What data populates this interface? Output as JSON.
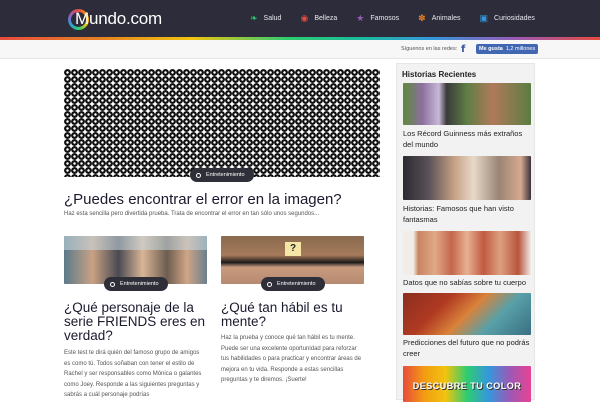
{
  "header": {
    "logo_text": "Mundo.com",
    "nav": [
      {
        "label": "Salud",
        "icon": "leaf-icon",
        "glyph": "❧",
        "color": "#2ecc71"
      },
      {
        "label": "Belleza",
        "icon": "lips-icon",
        "glyph": "◉",
        "color": "#e84c3d"
      },
      {
        "label": "Famosos",
        "icon": "star-icon",
        "glyph": "★",
        "color": "#9b59b6"
      },
      {
        "label": "Animales",
        "icon": "paw-icon",
        "glyph": "✽",
        "color": "#e67e22"
      },
      {
        "label": "Curiosidades",
        "icon": "chat-icon",
        "glyph": "▣",
        "color": "#3498db"
      }
    ]
  },
  "social": {
    "follow_text": "Síguenos en las redes:",
    "fb_like_label": "Me gusta",
    "fb_like_count": "1,2 millones"
  },
  "featured": {
    "category": "Entretenimiento",
    "title": "¿Puedes encontrar el error en la imagen?",
    "excerpt": "Haz esta sencilla pero divertida prueba. Trata de encontrar el error en tan sólo unos segundos..."
  },
  "cards": [
    {
      "category": "Entretenimiento",
      "title": "¿Qué personaje de la serie FRIENDS eres en verdad?",
      "excerpt": "Este test te dirá quién del famoso grupo de amigos es como tú. Todos soñaban con tener el estilo de Rachel y ser responsables como Mónica o galantes como Joey. Responde a las siguientes preguntas y sabrás a cuál personaje podrías"
    },
    {
      "category": "Entretenimiento",
      "title": "¿Qué tan hábil es tu mente?",
      "excerpt": "Haz la prueba y conoce qué tan hábil es tu mente. Puede ser una excelente oportunidad para reforzar tus habilidades o para practicar y encontrar áreas de mejora en tu vida. Responde a estas sencillas preguntas y te diremos. ¡Suerte!"
    }
  ],
  "sidebar": {
    "title": "Historias Recientes",
    "items": [
      {
        "caption": "Los Récord Guinness más extraños del mundo"
      },
      {
        "caption": "Historias: Famosos que han visto fantasmas"
      },
      {
        "caption": "Datos que no sabías sobre tu cuerpo"
      },
      {
        "caption": "Predicciones del futuro que no podrás creer"
      },
      {
        "caption": "",
        "banner_text": "DESCUBRE TU COLOR"
      }
    ]
  }
}
